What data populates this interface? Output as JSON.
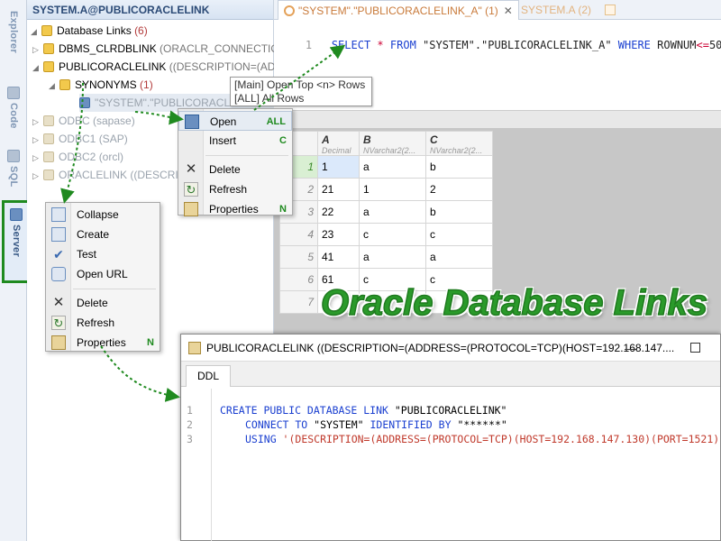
{
  "colors": {
    "accent_green": "#1f8a1f",
    "keyword_blue": "#1a3fd0",
    "tab_orange": "#c97a3a"
  },
  "vertical_tabs": [
    {
      "label": "Explorer",
      "icon": "explorer-icon"
    },
    {
      "label": "Code",
      "icon": "code-icon"
    },
    {
      "label": "SQL",
      "icon": "sql-icon"
    },
    {
      "label": "Server",
      "icon": "server-icon"
    }
  ],
  "explorer": {
    "header": "SYSTEM.A@PUBLICORACLELINK",
    "tree": {
      "root_label": "Database Links",
      "root_count": "(6)",
      "items": [
        {
          "name": "DBMS_CLRDBLINK",
          "detail": "(ORACLR_CONNECTION"
        },
        {
          "name": "PUBLICORACLELINK",
          "detail": "((DESCRIPTION=(ADDR"
        },
        {
          "name": "SYNONYMS",
          "detail": "(1)"
        },
        {
          "name": "\"SYSTEM\".\"PUBLICORACLE",
          "detail": ""
        },
        {
          "name": "ODBC",
          "detail": "(sapase)"
        },
        {
          "name": "ODBC1",
          "detail": "(SAP)"
        },
        {
          "name": "ODBC2",
          "detail": "(orcl)"
        },
        {
          "name": "ORACLELINK",
          "detail": "((DESCRIP"
        }
      ]
    }
  },
  "editor": {
    "tabs": [
      {
        "label": "\"SYSTEM\".\"PUBLICORACLELINK_A\" (1)",
        "close": "✕"
      },
      {
        "label": "SYSTEM.A (2)"
      }
    ],
    "line_number": "1",
    "sql": {
      "select": "SELECT",
      "star": "*",
      "from": "FROM",
      "table": "\"SYSTEM\".\"PUBLICORACLELINK_A\"",
      "where": "WHERE",
      "col": "ROWNUM",
      "op": "<=",
      "num": "500"
    }
  },
  "tooltip": {
    "line1": "[Main] Open Top <n> Rows",
    "line2": "[ALL] All Rows"
  },
  "grid": {
    "columns": [
      {
        "name": "A",
        "type": "Decimal"
      },
      {
        "name": "B",
        "type": "NVarchar2(2..."
      },
      {
        "name": "C",
        "type": "NVarchar2(2..."
      }
    ],
    "rows": [
      {
        "n": "1",
        "a": "1",
        "b": "a",
        "c": "b"
      },
      {
        "n": "2",
        "a": "21",
        "b": "1",
        "c": "2"
      },
      {
        "n": "3",
        "a": "22",
        "b": "a",
        "c": "b"
      },
      {
        "n": "4",
        "a": "23",
        "b": "c",
        "c": "c"
      },
      {
        "n": "5",
        "a": "41",
        "b": "a",
        "c": "a"
      },
      {
        "n": "6",
        "a": "61",
        "b": "c",
        "c": "c"
      },
      {
        "n": "7",
        "a": "6",
        "b": "",
        "c": ""
      }
    ]
  },
  "overlay_title": "Oracle Database Links",
  "menu_synonym": {
    "items": [
      {
        "label": "Open",
        "shortcut": "ALL",
        "icon": "open-table-icon"
      },
      {
        "label": "Insert",
        "shortcut": "C",
        "icon": ""
      },
      {
        "label": "Delete",
        "shortcut": "",
        "icon": "delete-icon"
      },
      {
        "label": "Refresh",
        "shortcut": "",
        "icon": "refresh-icon"
      },
      {
        "label": "Properties",
        "shortcut": "N",
        "icon": "properties-icon"
      }
    ]
  },
  "menu_link": {
    "items": [
      {
        "label": "Collapse",
        "shortcut": "",
        "icon": "collapse-icon"
      },
      {
        "label": "Create",
        "shortcut": "",
        "icon": "create-icon"
      },
      {
        "label": "Test",
        "shortcut": "",
        "icon": "check-icon"
      },
      {
        "label": "Open URL",
        "shortcut": "",
        "icon": "globe-icon"
      },
      {
        "label": "Delete",
        "shortcut": "",
        "icon": "delete-icon"
      },
      {
        "label": "Refresh",
        "shortcut": "",
        "icon": "refresh-icon"
      },
      {
        "label": "Properties",
        "shortcut": "N",
        "icon": "properties-icon"
      }
    ]
  },
  "ddl_window": {
    "title": "PUBLICORACLELINK ((DESCRIPTION=(ADDRESS=(PROTOCOL=TCP)(HOST=192.168.147....",
    "tab": "DDL",
    "lines": [
      {
        "n": "1",
        "kw": "CREATE PUBLIC DATABASE LINK",
        "rest": " \"PUBLICORACLELINK\""
      },
      {
        "n": "2",
        "kw": "CONNECT TO",
        "mid": " \"SYSTEM\" ",
        "kw2": "IDENTIFIED BY",
        "rest": " \"******\""
      },
      {
        "n": "3",
        "kw": "USING",
        "rest": " '(DESCRIPTION=(ADDRESS=(PROTOCOL=TCP)(HOST=192.168.147.130)(PORT=1521)"
      }
    ]
  }
}
